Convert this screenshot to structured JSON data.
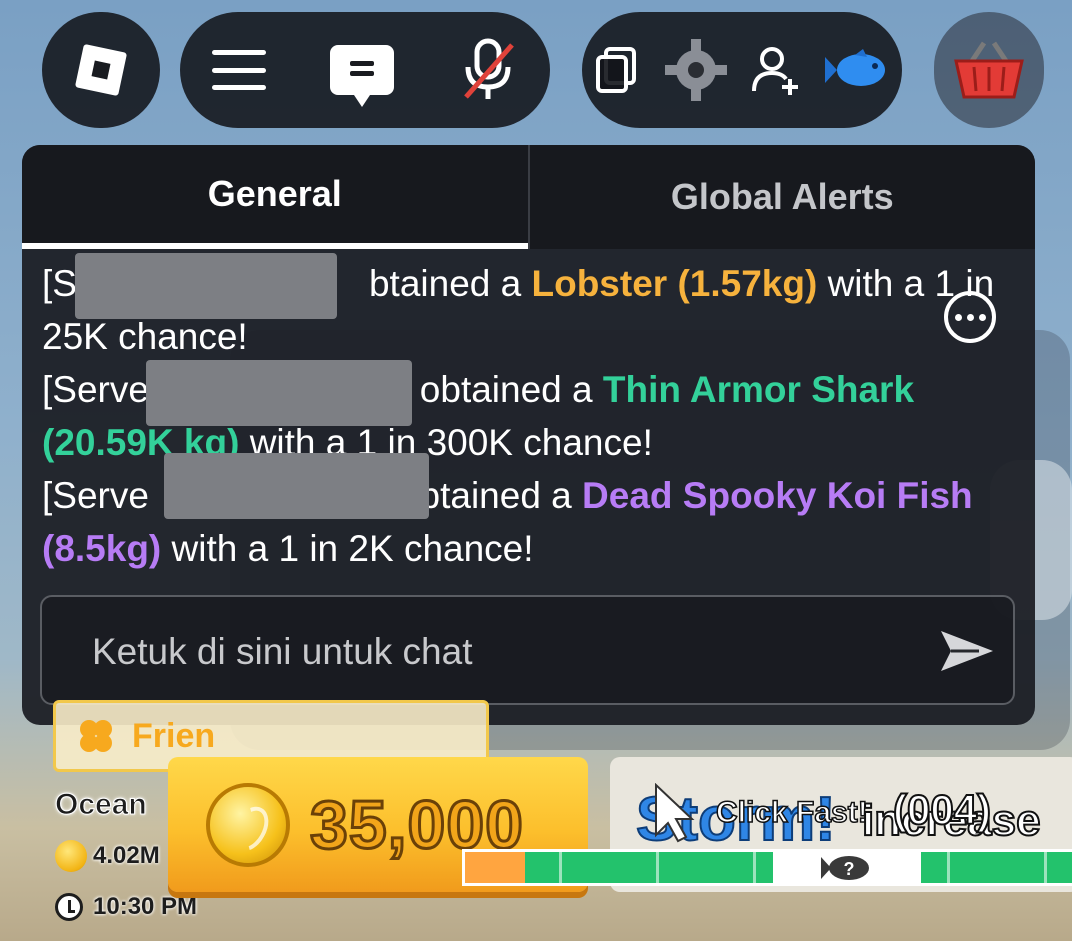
{
  "topbar": {
    "icons": [
      "roblox-logo-icon",
      "menu-icon",
      "chat-icon",
      "mic-muted-icon",
      "copy-icon",
      "gear-icon",
      "add-friend-icon",
      "fish-icon",
      "basket-icon"
    ]
  },
  "chat": {
    "tabs": [
      {
        "label": "General",
        "active": true
      },
      {
        "label": "Global Alerts",
        "active": false
      }
    ],
    "messages": [
      {
        "prefix": "[S",
        "mid": "btained a ",
        "item": "Lobster (1.57kg)",
        "suffix": " with a 1 in 25K chance!"
      },
      {
        "prefix": "[Serve",
        "mid": "9 obtained a ",
        "item": "Thin Armor Shark (20.59K kg)",
        "suffix": " with a 1 in 300K chance!"
      },
      {
        "prefix": "[Serve",
        "mid": "obtained a ",
        "item": "Dead Spooky Koi Fish (8.5kg)",
        "suffix": " with a 1 in 2K chance!"
      }
    ],
    "input_placeholder": "Ketuk di sini untuk chat"
  },
  "hud": {
    "friend_luck": "Frien",
    "location": "Ocean",
    "money": "4.02M",
    "time": "10:30 PM",
    "coin_button_amount": "35,000",
    "event_word": "Storm!",
    "event_suffix": "increase",
    "click_fast": "Click Fast!",
    "click_counter": "(004)",
    "reel_fish_label": "?"
  },
  "colors": {
    "orange": "#f6b23d",
    "green": "#33d19a",
    "purple": "#b77cf5",
    "coin": "#fcbf2c",
    "reel_green": "#23c26c"
  }
}
